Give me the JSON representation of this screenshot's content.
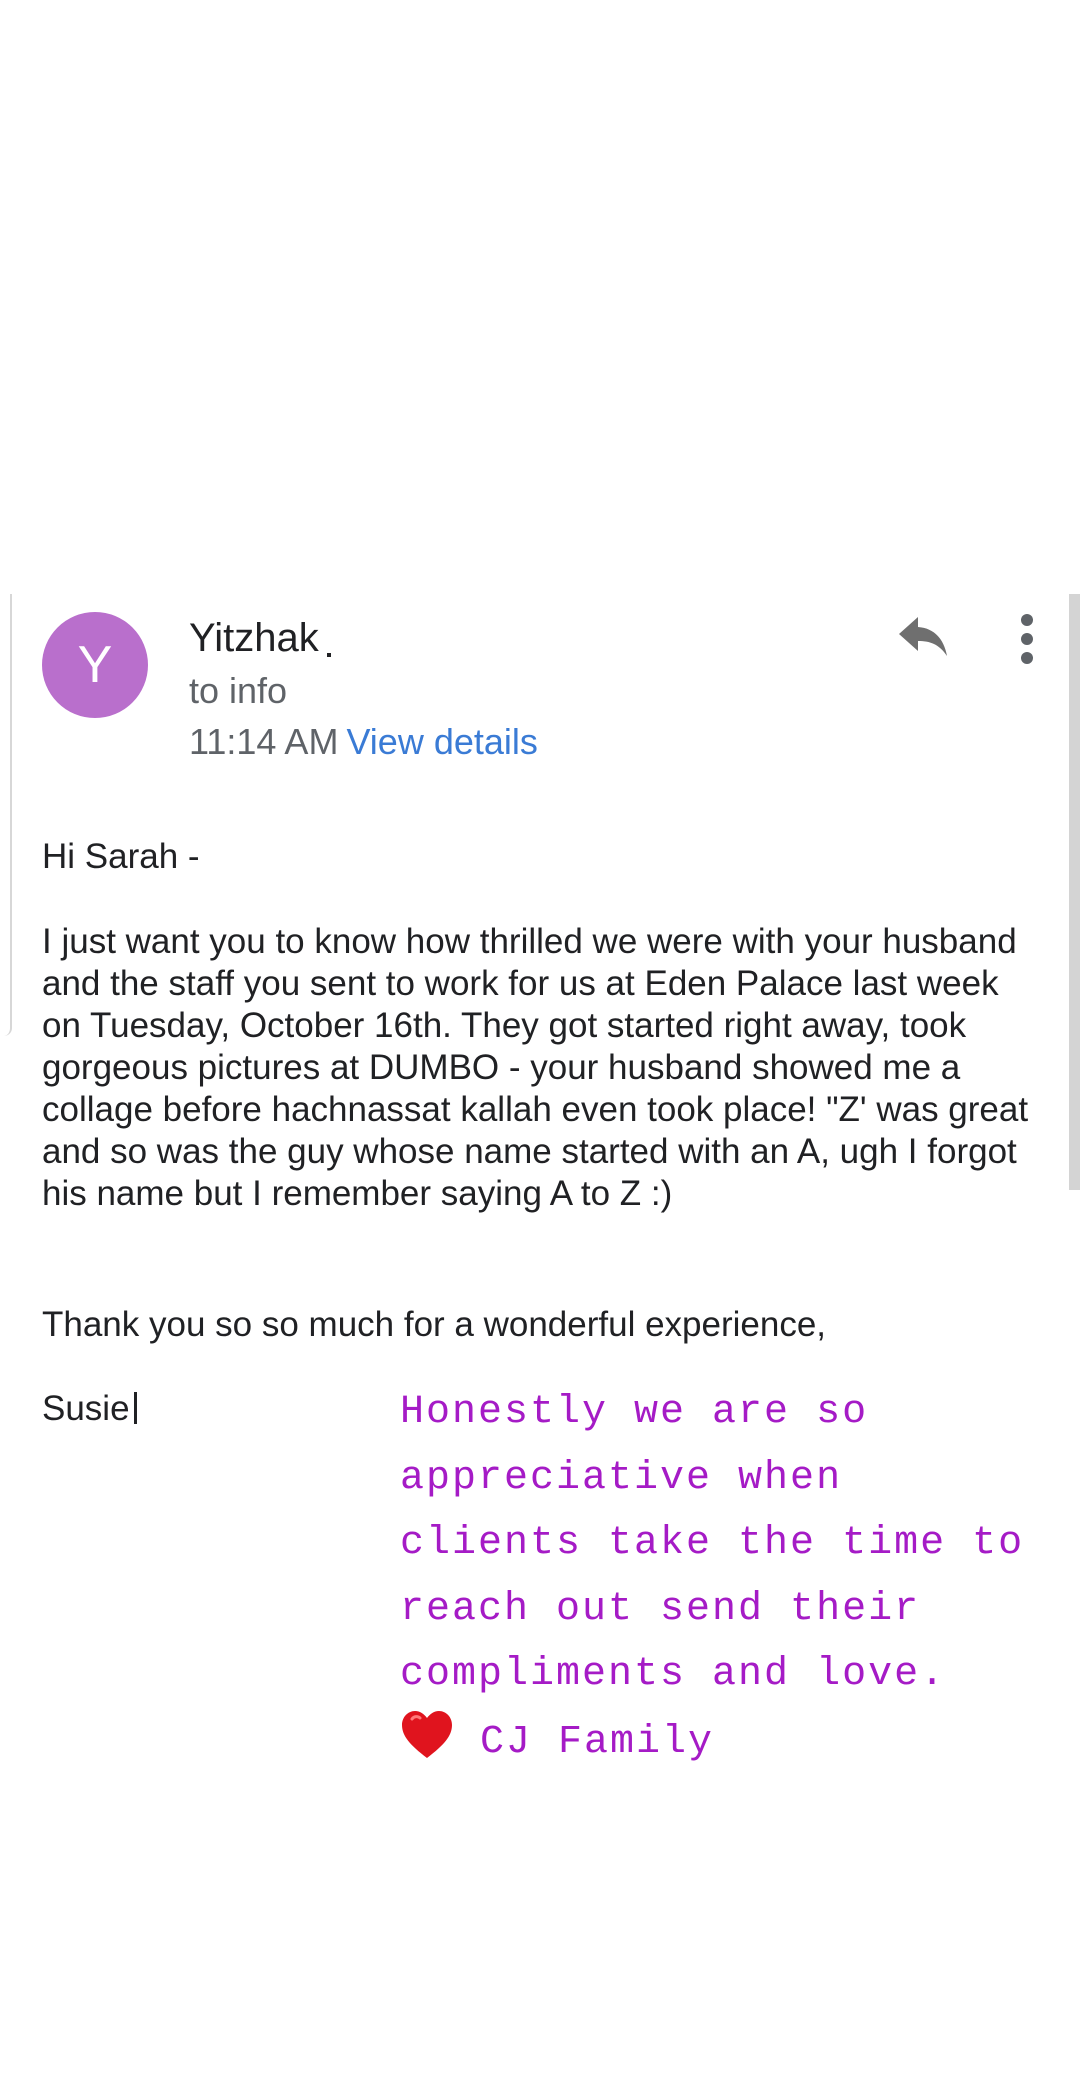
{
  "email": {
    "sender_name": "Yitzhak",
    "avatar_initial": "Y",
    "recipient": "to info",
    "time": "11:14 AM",
    "view_details": "View details",
    "greeting": "Hi Sarah -",
    "body": "I just want you to know how thrilled we were with your husband and the staff you sent to work for us at Eden Palace last week on Tuesday, October 16th. They got started right away, took gorgeous pictures at DUMBO - your husband showed me a collage before hachnassat kallah even took place! \"Z' was great and so was the guy whose name started with an A, ugh I forgot his name but I remember saying A to Z :)",
    "thanks": "Thank you so so much for a wonderful experience,",
    "signature": "Susie"
  },
  "story_overlay": {
    "message": "Honestly we are so appreciative when clients take the time to reach out send their compliments and love.",
    "signature": "CJ Family"
  },
  "icons": {
    "reply": "reply-icon",
    "more": "more-vert-icon",
    "heart": "heart-emoji"
  },
  "colors": {
    "avatar_bg": "#b96fcc",
    "link": "#3a7bd5",
    "overlay_text": "#a51bc6",
    "heart": "#e0141e"
  }
}
